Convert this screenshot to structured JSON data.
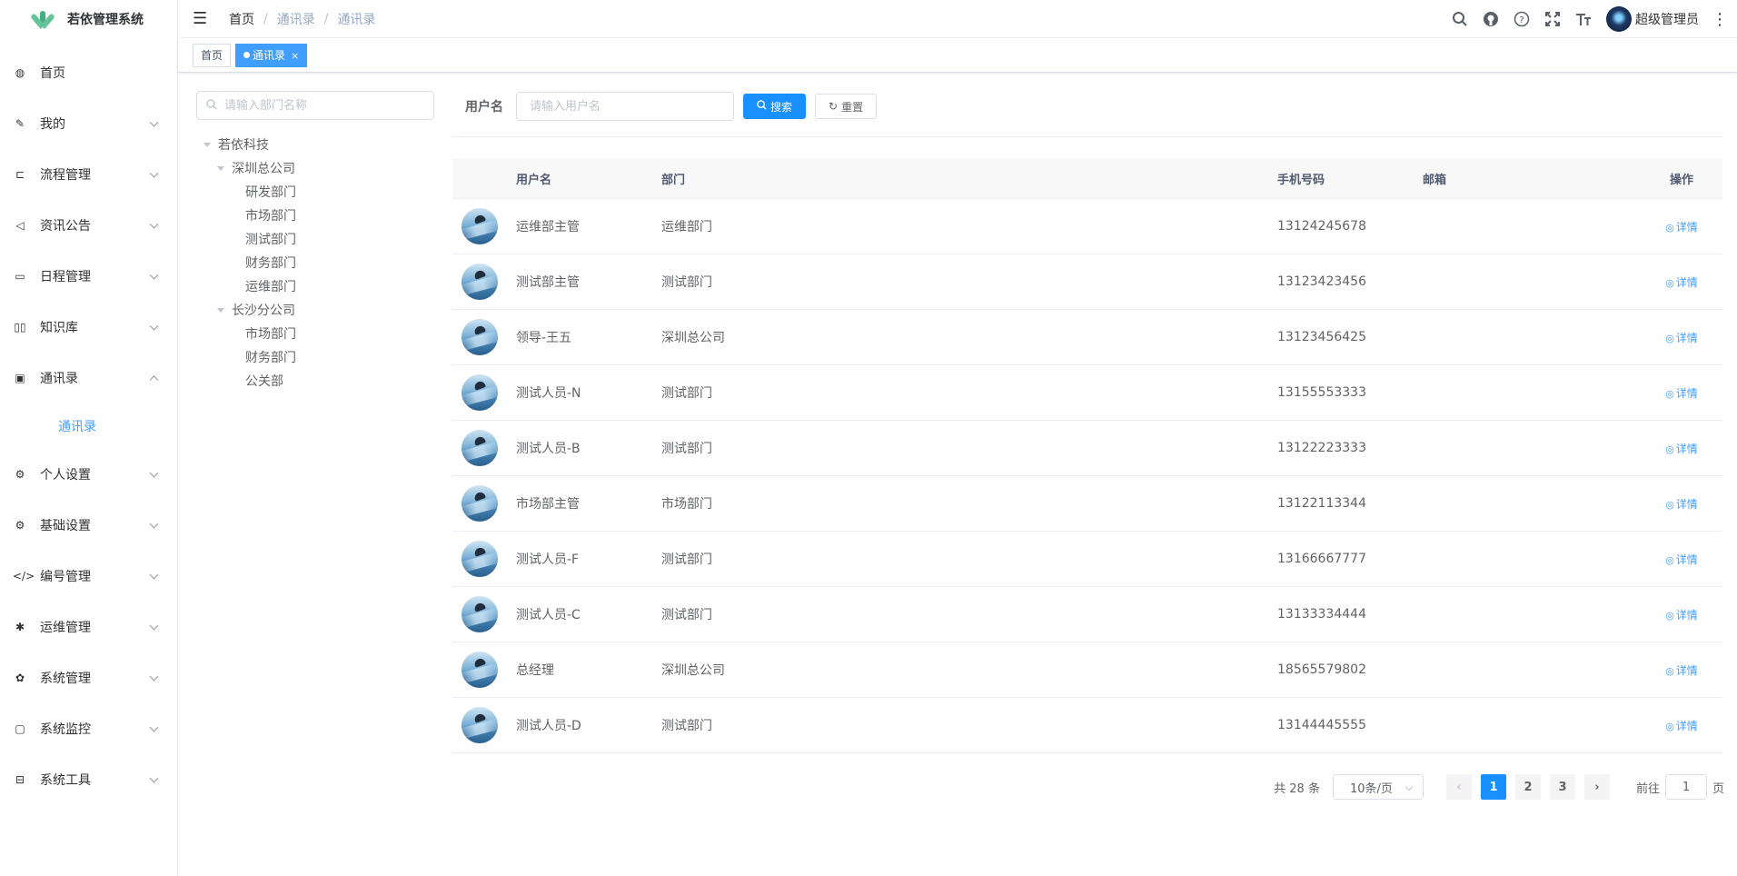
{
  "app": {
    "title": "若依管理系统"
  },
  "sidebar": {
    "items": [
      {
        "label": "首页",
        "icon": "dashboard-icon",
        "glyph": "◍",
        "arrow": ""
      },
      {
        "label": "我的",
        "icon": "edit-icon",
        "glyph": "✎",
        "arrow": "down"
      },
      {
        "label": "流程管理",
        "icon": "flow-icon",
        "glyph": "⊏",
        "arrow": "down"
      },
      {
        "label": "资讯公告",
        "icon": "megaphone-icon",
        "glyph": "◁",
        "arrow": "down"
      },
      {
        "label": "日程管理",
        "icon": "calendar-icon",
        "glyph": "▭",
        "arrow": "down"
      },
      {
        "label": "知识库",
        "icon": "book-icon",
        "glyph": "▯▯",
        "arrow": "down"
      },
      {
        "label": "通讯录",
        "icon": "contacts-icon",
        "glyph": "▣",
        "arrow": "up"
      },
      {
        "label": "个人设置",
        "icon": "settings-icon",
        "glyph": "⚙",
        "arrow": "down"
      },
      {
        "label": "基础设置",
        "icon": "settings-icon",
        "glyph": "⚙",
        "arrow": "down"
      },
      {
        "label": "编号管理",
        "icon": "code-icon",
        "glyph": "</>",
        "arrow": "down"
      },
      {
        "label": "运维管理",
        "icon": "bug-icon",
        "glyph": "✱",
        "arrow": "down"
      },
      {
        "label": "系统管理",
        "icon": "gear-icon",
        "glyph": "✿",
        "arrow": "down"
      },
      {
        "label": "系统监控",
        "icon": "monitor-icon",
        "glyph": "▢",
        "arrow": "down"
      },
      {
        "label": "系统工具",
        "icon": "toolbox-icon",
        "glyph": "⊟",
        "arrow": "down"
      }
    ],
    "sub_item": "通讯录"
  },
  "navbar": {
    "breadcrumb": [
      "首页",
      "通讯录",
      "通讯录"
    ],
    "user_name": "超级管理员"
  },
  "tags": {
    "home": "首页",
    "active": "通讯录",
    "close": "×"
  },
  "tree": {
    "search_placeholder": "请输入部门名称",
    "nodes": [
      {
        "label": "若依科技",
        "level": 0,
        "expanded": true
      },
      {
        "label": "深圳总公司",
        "level": 1,
        "expanded": true
      },
      {
        "label": "研发部门",
        "level": 2
      },
      {
        "label": "市场部门",
        "level": 2
      },
      {
        "label": "测试部门",
        "level": 2
      },
      {
        "label": "财务部门",
        "level": 2
      },
      {
        "label": "运维部门",
        "level": 2
      },
      {
        "label": "长沙分公司",
        "level": 1,
        "expanded": true
      },
      {
        "label": "市场部门",
        "level": 2
      },
      {
        "label": "财务部门",
        "level": 2
      },
      {
        "label": "公关部",
        "level": 2
      }
    ]
  },
  "search": {
    "label": "用户名",
    "placeholder": "请输入用户名",
    "search_btn": "搜索",
    "reset_btn": "重置"
  },
  "table": {
    "headers": {
      "name": "用户名",
      "dept": "部门",
      "phone": "手机号码",
      "email": "邮箱",
      "op": "操作"
    },
    "detail_label": "详情",
    "rows": [
      {
        "name": "运维部主管",
        "dept": "运维部门",
        "phone": "13124245678",
        "email": ""
      },
      {
        "name": "测试部主管",
        "dept": "测试部门",
        "phone": "13123423456",
        "email": ""
      },
      {
        "name": "领导-王五",
        "dept": "深圳总公司",
        "phone": "13123456425",
        "email": ""
      },
      {
        "name": "测试人员-N",
        "dept": "测试部门",
        "phone": "13155553333",
        "email": ""
      },
      {
        "name": "测试人员-B",
        "dept": "测试部门",
        "phone": "13122223333",
        "email": ""
      },
      {
        "name": "市场部主管",
        "dept": "市场部门",
        "phone": "13122113344",
        "email": ""
      },
      {
        "name": "测试人员-F",
        "dept": "测试部门",
        "phone": "13166667777",
        "email": ""
      },
      {
        "name": "测试人员-C",
        "dept": "测试部门",
        "phone": "13133334444",
        "email": ""
      },
      {
        "name": "总经理",
        "dept": "深圳总公司",
        "phone": "18565579802",
        "email": ""
      },
      {
        "name": "测试人员-D",
        "dept": "测试部门",
        "phone": "13144445555",
        "email": ""
      }
    ]
  },
  "pagination": {
    "total": "共 28 条",
    "page_size": "10条/页",
    "pages": [
      "1",
      "2",
      "3"
    ],
    "current": "1",
    "goto_prefix": "前往",
    "goto_value": "1",
    "goto_suffix": "页",
    "prev": "‹",
    "next": "›"
  },
  "colors": {
    "primary": "#1890ff",
    "link": "#409eff"
  }
}
